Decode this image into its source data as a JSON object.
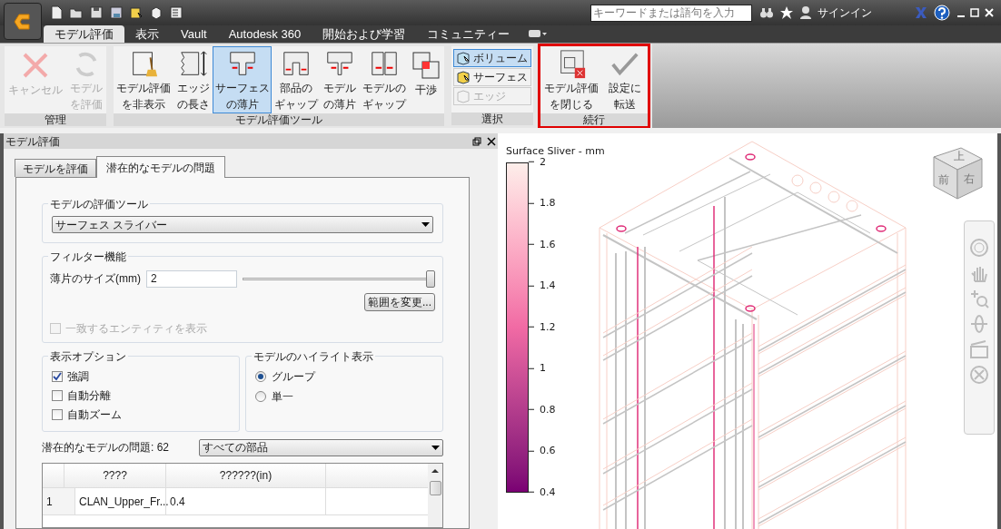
{
  "title_bar": {
    "search": {
      "placeholder": "キーワードまたは語句を入力"
    },
    "sign_in": "サインイン"
  },
  "ribbon_tabs": [
    {
      "label": "モデル評価",
      "selected": true
    },
    {
      "label": "表示",
      "selected": false
    },
    {
      "label": "Vault",
      "selected": false
    },
    {
      "label": "Autodesk 360",
      "selected": false
    },
    {
      "label": "開始および学習",
      "selected": false
    },
    {
      "label": "コミュニティー",
      "selected": false
    }
  ],
  "ribbon_panels": [
    {
      "title": "管理",
      "buttons": [
        {
          "label_lines": [
            "キャンセル"
          ],
          "disabled": true,
          "selected": false
        },
        {
          "label_lines": [
            "モデル",
            "を評価"
          ],
          "disabled": true,
          "selected": false
        }
      ]
    },
    {
      "title": "モデル評価ツール",
      "buttons": [
        {
          "label_lines": [
            "モデル評価",
            "を非表示"
          ],
          "disabled": false,
          "selected": false
        },
        {
          "label_lines": [
            "エッジ",
            "の長さ"
          ],
          "disabled": false,
          "selected": false
        },
        {
          "label_lines": [
            "サーフェス",
            "の薄片"
          ],
          "disabled": false,
          "selected": true
        },
        {
          "label_lines": [
            "部品の",
            "ギャップ"
          ],
          "disabled": false,
          "selected": false
        },
        {
          "label_lines": [
            "モデル",
            "の薄片"
          ],
          "disabled": false,
          "selected": false
        },
        {
          "label_lines": [
            "モデルの",
            "ギャップ"
          ],
          "disabled": false,
          "selected": false
        },
        {
          "label_lines": [
            "干渉"
          ],
          "disabled": false,
          "selected": false
        }
      ]
    },
    {
      "title": "選択",
      "small_buttons": [
        {
          "label": "ボリューム",
          "disabled": false,
          "selected": true
        },
        {
          "label": "サーフェス",
          "disabled": false,
          "selected": false
        },
        {
          "label": "エッジ",
          "disabled": true,
          "selected": false
        }
      ]
    },
    {
      "title": "続行",
      "highlighted": true,
      "buttons": [
        {
          "label_lines": [
            "モデル評価",
            "を閉じる"
          ],
          "disabled": false,
          "selected": false
        },
        {
          "label_lines": [
            "設定に",
            "転送"
          ],
          "disabled": false,
          "selected": false
        }
      ]
    }
  ],
  "panel": {
    "title": "モデル評価",
    "tabs": [
      {
        "label": "モデルを評価",
        "selected": false
      },
      {
        "label": "潜在的なモデルの問題",
        "selected": true
      }
    ],
    "tool_group": {
      "title": "モデルの評価ツール",
      "value": "サーフェス スライバー"
    },
    "filter_group": {
      "title": "フィルター機能",
      "size_label": "薄片のサイズ(mm)",
      "size_value": "2",
      "slider": {
        "level": 1
      },
      "range_button": "範囲を変更...",
      "match_checkbox": {
        "label": "一致するエンティティを表示",
        "checked": false,
        "disabled": true
      }
    },
    "display_options": {
      "title": "表示オプション",
      "checkboxes": [
        {
          "label": "強調",
          "checked": true
        },
        {
          "label": "自動分離",
          "checked": false
        },
        {
          "label": "自動ズーム",
          "checked": false
        }
      ]
    },
    "highlight": {
      "title": "モデルのハイライト表示",
      "radios": [
        {
          "label": "グループ",
          "selected": true
        },
        {
          "label": "単一",
          "selected": false
        }
      ]
    },
    "issues_label": "潜在的なモデルの問題: 62",
    "issues_filter": "すべての部品",
    "table": {
      "columns": [
        "",
        "????",
        "??????(in)"
      ],
      "rows": [
        [
          "1",
          "CLAN_Upper_Fr...",
          "0.4"
        ]
      ]
    }
  },
  "viewport": {
    "legend": {
      "title": "Surface Sliver - mm",
      "ticks": [
        "2",
        "1.8",
        "1.6",
        "1.4",
        "1.2",
        "1",
        "0.8",
        "0.6",
        "0.4"
      ]
    },
    "viewcube": {
      "top": "上",
      "front": "前",
      "right": "右"
    }
  }
}
